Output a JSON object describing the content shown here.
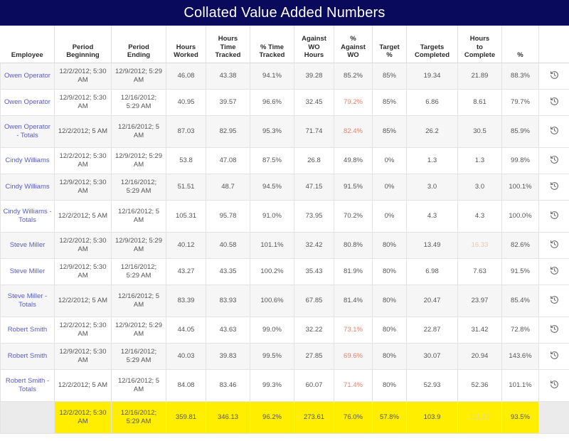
{
  "header": {
    "title": "Collated Value Added Numbers",
    "bar_color": "#0a0a5c"
  },
  "table": {
    "columns": [
      {
        "key": "employee",
        "label": "Employee"
      },
      {
        "key": "period_beginning",
        "label": "Period\nBeginning",
        "line1": "Period",
        "line2": "Beginning"
      },
      {
        "key": "period_ending",
        "label": "Period\nEnding",
        "line1": "Period",
        "line2": "Ending"
      },
      {
        "key": "hours_worked",
        "label": "Hours\nWorked",
        "line1": "Hours",
        "line2": "Worked"
      },
      {
        "key": "hours_time_tracked",
        "label": "Hours\nTime\nTracked",
        "line1": "Hours",
        "line2": "Time",
        "line3": "Tracked"
      },
      {
        "key": "pct_time_tracked",
        "label": "% Time\nTracked",
        "line1": "% Time",
        "line2": "Tracked"
      },
      {
        "key": "against_wo_hours",
        "label": "Against\nWO\nHours",
        "line1": "Against",
        "line2": "WO",
        "line3": "Hours"
      },
      {
        "key": "pct_against_wo",
        "label": "%\nAgainst\nWO",
        "line1": "%",
        "line2": "Against",
        "line3": "WO"
      },
      {
        "key": "target_pct",
        "label": "Target\n%",
        "line1": "Target",
        "line2": "%"
      },
      {
        "key": "targets_completed",
        "label": "Targets\nCompleted",
        "line1": "Targets",
        "line2": "Completed"
      },
      {
        "key": "hours_to_complete",
        "label": "Hours\nto\nComplete",
        "line1": "Hours",
        "line2": "to",
        "line3": "Complete"
      },
      {
        "key": "pct",
        "label": "%",
        "line1": "%"
      },
      {
        "key": "action",
        "label": ""
      }
    ],
    "rows": [
      {
        "employee": "Owen Operator",
        "period_beginning": "12/2/2012; 5:30 AM",
        "period_ending": "12/9/2012; 5:29 AM",
        "hours_worked": "46.08",
        "hours_time_tracked": "43.38",
        "pct_time_tracked": "94.1%",
        "against_wo_hours": "39.28",
        "pct_against_wo": "85.2%",
        "target_pct": "85%",
        "targets_completed": "19.34",
        "hours_to_complete": "21.89",
        "pct": "88.3%",
        "action_icon": "history-icon",
        "shade": true,
        "tall": false,
        "flags": {}
      },
      {
        "employee": "Owen Operator",
        "period_beginning": "12/9/2012; 5:30 AM",
        "period_ending": "12/16/2012; 5:29 AM",
        "hours_worked": "40.95",
        "hours_time_tracked": "39.57",
        "pct_time_tracked": "96.6%",
        "against_wo_hours": "32.45",
        "pct_against_wo": "79.2%",
        "target_pct": "85%",
        "targets_completed": "6.86",
        "hours_to_complete": "8.61",
        "pct": "79.7%",
        "action_icon": "history-icon",
        "shade": false,
        "tall": false,
        "flags": {
          "pct_against_wo": "warn"
        }
      },
      {
        "employee": "Owen Operator - Totals",
        "period_beginning": "12/2/2012; 5 AM",
        "period_ending": "12/16/2012; 5 AM",
        "hours_worked": "87.03",
        "hours_time_tracked": "82.95",
        "pct_time_tracked": "95.3%",
        "against_wo_hours": "71.74",
        "pct_against_wo": "82.4%",
        "target_pct": "85%",
        "targets_completed": "26.2",
        "hours_to_complete": "30.5",
        "pct": "85.9%",
        "action_icon": "history-icon",
        "shade": true,
        "tall": true,
        "flags": {
          "pct_against_wo": "warn"
        }
      },
      {
        "employee": "Cindy Williams",
        "period_beginning": "12/2/2012; 5:30 AM",
        "period_ending": "12/9/2012; 5:29 AM",
        "hours_worked": "53.8",
        "hours_time_tracked": "47.08",
        "pct_time_tracked": "87.5%",
        "against_wo_hours": "26.8",
        "pct_against_wo": "49.8%",
        "target_pct": "0%",
        "targets_completed": "1.3",
        "hours_to_complete": "1.3",
        "pct": "99.8%",
        "action_icon": "history-icon",
        "shade": false,
        "tall": false,
        "flags": {}
      },
      {
        "employee": "Cindy Williams",
        "period_beginning": "12/9/2012; 5:30 AM",
        "period_ending": "12/16/2012; 5:29 AM",
        "hours_worked": "51.51",
        "hours_time_tracked": "48.7",
        "pct_time_tracked": "94.5%",
        "against_wo_hours": "47.15",
        "pct_against_wo": "91.5%",
        "target_pct": "0%",
        "targets_completed": "3.0",
        "hours_to_complete": "3.0",
        "pct": "100.1%",
        "action_icon": "history-icon",
        "shade": true,
        "tall": false,
        "flags": {}
      },
      {
        "employee": "Cindy Williams - Totals",
        "period_beginning": "12/2/2012; 5 AM",
        "period_ending": "12/16/2012; 5 AM",
        "hours_worked": "105.31",
        "hours_time_tracked": "95.78",
        "pct_time_tracked": "91.0%",
        "against_wo_hours": "73.95",
        "pct_against_wo": "70.2%",
        "target_pct": "0%",
        "targets_completed": "4.3",
        "hours_to_complete": "4.3",
        "pct": "100.0%",
        "action_icon": "history-icon",
        "shade": false,
        "tall": true,
        "flags": {}
      },
      {
        "employee": "Steve Miller",
        "period_beginning": "12/2/2012; 5:30 AM",
        "period_ending": "12/9/2012; 5:29 AM",
        "hours_worked": "40.12",
        "hours_time_tracked": "40.58",
        "pct_time_tracked": "101.1%",
        "against_wo_hours": "32.42",
        "pct_against_wo": "80.8%",
        "target_pct": "80%",
        "targets_completed": "13.49",
        "hours_to_complete": "16.33",
        "pct": "82.6%",
        "action_icon": "history-icon",
        "shade": true,
        "tall": false,
        "flags": {
          "hours_to_complete": "soft"
        }
      },
      {
        "employee": "Steve Miller",
        "period_beginning": "12/9/2012; 5:30 AM",
        "period_ending": "12/16/2012; 5:29 AM",
        "hours_worked": "43.27",
        "hours_time_tracked": "43.35",
        "pct_time_tracked": "100.2%",
        "against_wo_hours": "35.43",
        "pct_against_wo": "81.9%",
        "target_pct": "80%",
        "targets_completed": "6.98",
        "hours_to_complete": "7.63",
        "pct": "91.5%",
        "action_icon": "history-icon",
        "shade": false,
        "tall": false,
        "flags": {}
      },
      {
        "employee": "Steve Miller - Totals",
        "period_beginning": "12/2/2012; 5 AM",
        "period_ending": "12/16/2012; 5 AM",
        "hours_worked": "83.39",
        "hours_time_tracked": "83.93",
        "pct_time_tracked": "100.6%",
        "against_wo_hours": "67.85",
        "pct_against_wo": "81.4%",
        "target_pct": "80%",
        "targets_completed": "20.47",
        "hours_to_complete": "23.97",
        "pct": "85.4%",
        "action_icon": "history-icon",
        "shade": true,
        "tall": true,
        "flags": {}
      },
      {
        "employee": "Robert Smith",
        "period_beginning": "12/2/2012; 5:30 AM",
        "period_ending": "12/9/2012; 5:29 AM",
        "hours_worked": "44.05",
        "hours_time_tracked": "43.63",
        "pct_time_tracked": "99.0%",
        "against_wo_hours": "32.22",
        "pct_against_wo": "73.1%",
        "target_pct": "80%",
        "targets_completed": "22.87",
        "hours_to_complete": "31.42",
        "pct": "72.8%",
        "action_icon": "history-icon",
        "shade": false,
        "tall": false,
        "flags": {
          "pct_against_wo": "warn"
        }
      },
      {
        "employee": "Robert Smith",
        "period_beginning": "12/9/2012; 5:30 AM",
        "period_ending": "12/16/2012; 5:29 AM",
        "hours_worked": "40.03",
        "hours_time_tracked": "39.83",
        "pct_time_tracked": "99.5%",
        "against_wo_hours": "27.85",
        "pct_against_wo": "69.6%",
        "target_pct": "80%",
        "targets_completed": "30.07",
        "hours_to_complete": "20.94",
        "pct": "143.6%",
        "action_icon": "history-icon",
        "shade": true,
        "tall": false,
        "flags": {
          "pct_against_wo": "warn"
        }
      },
      {
        "employee": "Robert Smith - Totals",
        "period_beginning": "12/2/2012; 5 AM",
        "period_ending": "12/16/2012; 5 AM",
        "hours_worked": "84.08",
        "hours_time_tracked": "83.46",
        "pct_time_tracked": "99.3%",
        "against_wo_hours": "60.07",
        "pct_against_wo": "71.4%",
        "target_pct": "80%",
        "targets_completed": "52.93",
        "hours_to_complete": "52.36",
        "pct": "101.1%",
        "action_icon": "history-icon",
        "shade": false,
        "tall": true,
        "flags": {
          "pct_against_wo": "warn"
        }
      }
    ],
    "grand_total": {
      "employee": "",
      "period_beginning": "12/2/2012; 5:30 AM",
      "period_ending": "12/16/2012; 5:29 AM",
      "hours_worked": "359.81",
      "hours_time_tracked": "346.13",
      "pct_time_tracked": "96.2%",
      "against_wo_hours": "273.61",
      "pct_against_wo": "76.0%",
      "target_pct": "57.8%",
      "targets_completed": "103.9",
      "hours_to_complete": "111.13",
      "pct": "93.5%",
      "action_icon": "",
      "flags": {
        "hours_to_complete": "soft"
      }
    }
  },
  "colors": {
    "title_bar": "#0a0a5c",
    "employee_link": "#5a5acd",
    "warning_text": "#e8826a",
    "grand_total_highlight": "#ffee00",
    "row_shade": "#f6f6f6",
    "grid_line": "#e3e3e3"
  }
}
